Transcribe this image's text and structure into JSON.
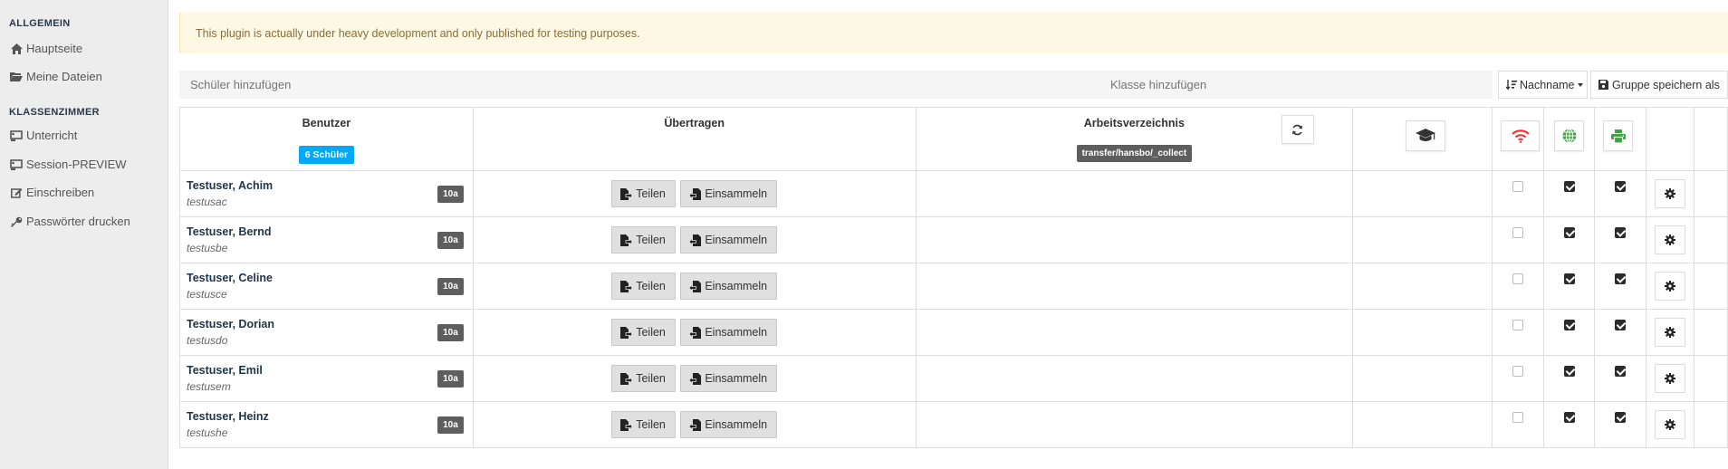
{
  "sidebar": {
    "sections": [
      {
        "title": "ALLGEMEIN",
        "items": [
          {
            "label": "Hauptseite",
            "icon": "home-icon"
          },
          {
            "label": "Meine Dateien",
            "icon": "folder-open-icon"
          }
        ]
      },
      {
        "title": "KLASSENZIMMER",
        "items": [
          {
            "label": "Unterricht",
            "icon": "chalkboard-icon"
          },
          {
            "label": "Session-PREVIEW",
            "icon": "chalkboard-icon"
          },
          {
            "label": "Einschreiben",
            "icon": "edit-icon"
          },
          {
            "label": "Passwörter drucken",
            "icon": "key-icon"
          }
        ]
      }
    ]
  },
  "alert": {
    "text": "This plugin is actually under heavy development and only published for testing purposes."
  },
  "toolbar": {
    "student_placeholder": "Schüler hinzufügen",
    "class_placeholder": "Klasse hinzufügen",
    "sort_label": "Nachname",
    "save_label": "Gruppe speichern als"
  },
  "table": {
    "headers": {
      "user": "Benutzer",
      "student_count": "6 Schüler",
      "transfer": "Übertragen",
      "workdir": "Arbeitsverzeichnis",
      "workdir_path": "transfer/hansbo/_collect"
    },
    "share_label": "Teilen",
    "collect_label": "Einsammeln",
    "rows": [
      {
        "name": "Testuser, Achim",
        "login": "testusac",
        "class": "10a",
        "internet": false,
        "web": true,
        "printer": true
      },
      {
        "name": "Testuser, Bernd",
        "login": "testusbe",
        "class": "10a",
        "internet": false,
        "web": true,
        "printer": true
      },
      {
        "name": "Testuser, Celine",
        "login": "testusce",
        "class": "10a",
        "internet": false,
        "web": true,
        "printer": true
      },
      {
        "name": "Testuser, Dorian",
        "login": "testusdo",
        "class": "10a",
        "internet": false,
        "web": true,
        "printer": true
      },
      {
        "name": "Testuser, Emil",
        "login": "testusem",
        "class": "10a",
        "internet": false,
        "web": true,
        "printer": true
      },
      {
        "name": "Testuser, Heinz",
        "login": "testushe",
        "class": "10a",
        "internet": false,
        "web": true,
        "printer": true
      }
    ]
  },
  "colors": {
    "wifi": "#e53935",
    "globe": "#43a047",
    "printer": "#43a047",
    "badge_blue": "#03a9f4"
  }
}
